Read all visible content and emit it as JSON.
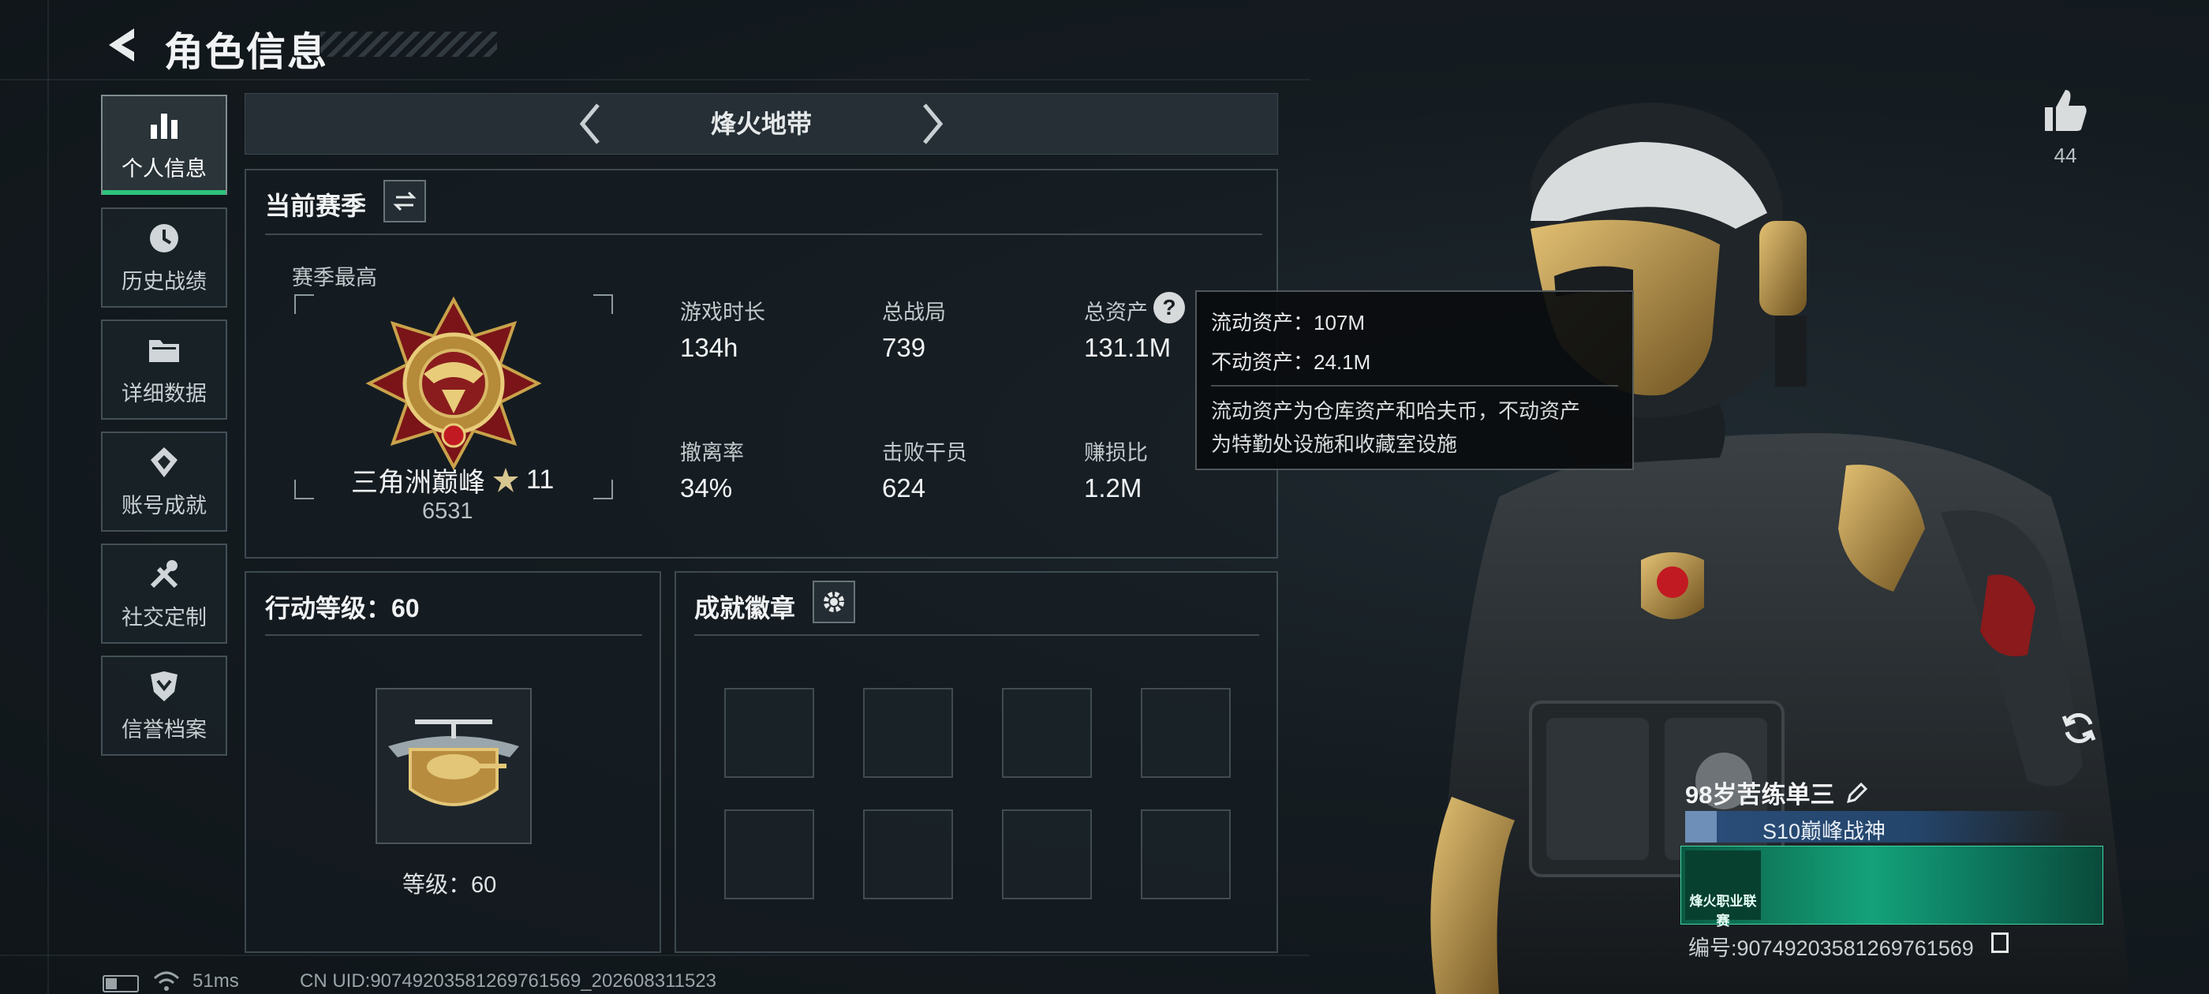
{
  "header": {
    "title": "角色信息"
  },
  "nav": {
    "items": [
      {
        "label": "个人信息",
        "icon": "bar-chart-icon",
        "active": true
      },
      {
        "label": "历史战绩",
        "icon": "clock-icon",
        "active": false
      },
      {
        "label": "详细数据",
        "icon": "folder-icon",
        "active": false
      },
      {
        "label": "账号成就",
        "icon": "trophy-icon",
        "active": false
      },
      {
        "label": "社交定制",
        "icon": "tools-icon",
        "active": false
      },
      {
        "label": "信誉档案",
        "icon": "shield-icon",
        "active": false
      }
    ]
  },
  "mode": {
    "title": "烽火地带"
  },
  "season": {
    "title": "当前赛季",
    "best_label": "赛季最高",
    "rank_name": "三角洲巅峰",
    "rank_stars": "11",
    "rank_score": "6531",
    "stats": [
      {
        "label": "游戏时长",
        "value": "134h"
      },
      {
        "label": "总战局",
        "value": "739"
      },
      {
        "label": "总资产",
        "value": "131.1M"
      },
      {
        "label": "撤离率",
        "value": "34%"
      },
      {
        "label": "击败干员",
        "value": "624"
      },
      {
        "label": "赚损比",
        "value": "1.2M"
      }
    ]
  },
  "tooltip": {
    "liquid": "流动资产：107M",
    "fixed": "不动资产：24.1M",
    "desc_line1": "流动资产为仓库资产和哈夫币，不动资产",
    "desc_line2": "为特勤处设施和收藏室设施"
  },
  "action_level": {
    "title": "行动等级：60",
    "level_text": "等级：60"
  },
  "achievements": {
    "title": "成就徽章",
    "slots": 8
  },
  "profile": {
    "likes": "44",
    "player_name": "98岁苦练单三",
    "player_title": "S10巅峰战神",
    "banner_text": "烽火职业联赛",
    "player_id": "编号:9074920358126976156​9"
  },
  "status_bar": {
    "ping": "51ms",
    "uid": "CN UID:9074920358126976156​9_202608311523"
  },
  "colors": {
    "accent_green": "#2ec27e",
    "gold": "#c9a24a",
    "panel_border": "#5a6a72"
  }
}
